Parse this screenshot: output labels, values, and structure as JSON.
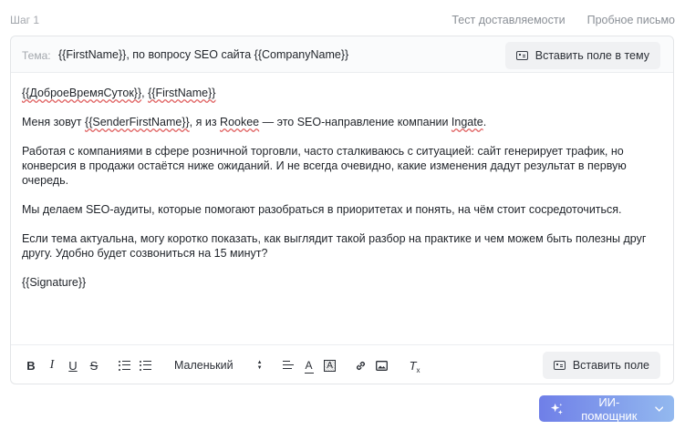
{
  "header": {
    "step": "Шаг 1",
    "links": [
      "Тест доставляемости",
      "Пробное письмо"
    ]
  },
  "subject": {
    "label": "Тема:",
    "value": "{{FirstName}}, по вопросу SEO сайта {{CompanyName}}",
    "insert_button": "Вставить поле в тему"
  },
  "body": {
    "greeting_a": "{{ДоброеВремяСуток}}",
    "greeting_sep": ", ",
    "greeting_b": "{{FirstName}}",
    "p1_pre": "Меня зовут ",
    "p1_sender": "{{SenderFirstName}}",
    "p1_mid": ", я из ",
    "p1_company": "Rookee",
    "p1_post": " — это SEO-направление компании ",
    "p1_ingate": "Ingate",
    "p1_end": ".",
    "p2": "Работая с компаниями в сфере розничной торговли, часто сталкиваюсь с ситуацией: сайт генерирует трафик, но конверсия в продажи остаётся ниже ожиданий. И не всегда очевидно, какие изменения дадут результат в первую очередь.",
    "p3": "Мы делаем SEO-аудиты, которые помогают разобраться в приоритетах и понять, на чём стоит сосредоточиться.",
    "p4": "Если тема актуальна, могу коротко показать, как выглядит такой разбор на практике и чем можем быть полезны друг другу. Удобно будет созвониться на 15 минут?",
    "signature": "{{Signature}}"
  },
  "toolbar": {
    "bold": "B",
    "italic": "I",
    "underline": "U",
    "strike": "S",
    "font_size": "Маленький",
    "font_color": "A",
    "highlight": "A",
    "clear_format": "T",
    "clear_format_x": "x",
    "insert_field": "Вставить поле"
  },
  "ai_assistant": {
    "label": "ИИ-помощник"
  },
  "icons": {
    "field": "field-tag-icon",
    "sparkle": "sparkle-icon",
    "chevron": "chevron-down-icon",
    "link": "link-icon",
    "image": "image-icon"
  },
  "colors": {
    "accent_start": "#6f7fe8",
    "accent_end": "#93b9ef",
    "spell_error": "#e06060"
  }
}
